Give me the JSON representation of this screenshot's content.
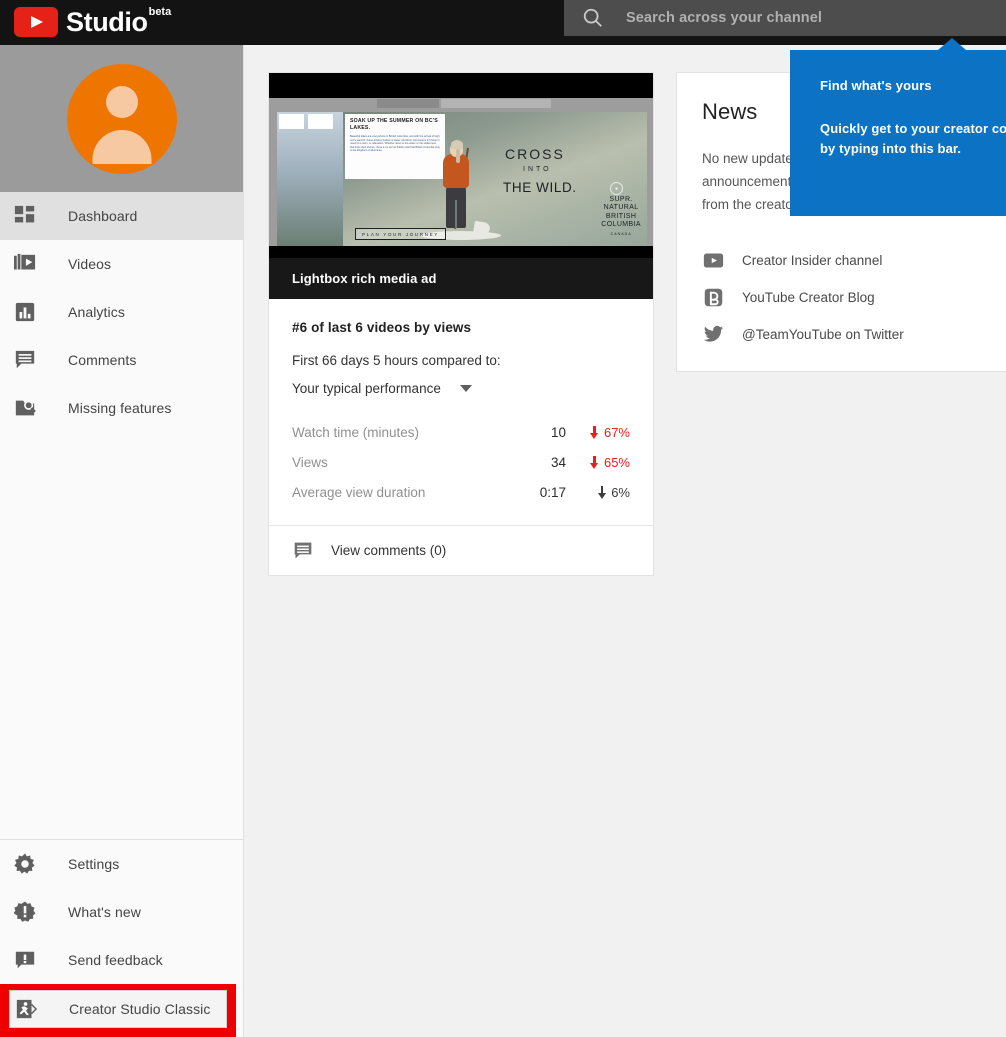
{
  "topbar": {
    "brand_name": "Studio",
    "brand_badge": "beta",
    "logo_icon": "youtube-play-icon",
    "search": {
      "icon": "search-icon",
      "placeholder": "Search across your channel",
      "value": ""
    }
  },
  "sidebar": {
    "avatar_icon": "default-user-avatar",
    "items": [
      {
        "label": "Dashboard",
        "icon": "dashboard-grid-icon",
        "active": true
      },
      {
        "label": "Videos",
        "icon": "videos-stack-icon",
        "active": false
      },
      {
        "label": "Analytics",
        "icon": "analytics-bar-icon",
        "active": false
      },
      {
        "label": "Comments",
        "icon": "comments-bubble-icon",
        "active": false
      },
      {
        "label": "Missing features",
        "icon": "missing-features-icon",
        "active": false
      }
    ],
    "bottom_items": [
      {
        "label": "Settings",
        "icon": "gear-icon"
      },
      {
        "label": "What's new",
        "icon": "exclamation-badge-icon"
      },
      {
        "label": "Send feedback",
        "icon": "feedback-bubble-icon"
      }
    ],
    "classic": {
      "label": "Creator Studio Classic",
      "icon": "exit-runner-icon",
      "highlight_color": "#ee0000",
      "highlighted": true
    }
  },
  "main": {
    "video_card": {
      "title": "Lightbox rich media ad",
      "rank_line": "#6 of last 6 videos by views",
      "compare_line": "First 66 days 5 hours compared to:",
      "compare_selected": "Your typical performance",
      "compare_caret_icon": "chevron-down-icon",
      "metrics": [
        {
          "name": "Watch time (minutes)",
          "value": "10",
          "delta": "67%",
          "direction": "down",
          "color": "#e62117"
        },
        {
          "name": "Views",
          "value": "34",
          "delta": "65%",
          "direction": "down",
          "color": "#e62117"
        },
        {
          "name": "Average view duration",
          "value": "0:17",
          "delta": "6%",
          "direction": "down",
          "color": "#3b3b3b"
        }
      ],
      "footer_label": "View comments (0)",
      "footer_icon": "comments-bubble-icon",
      "thumbnail": {
        "ad_headline": "SOAK UP THE SUMMER ON BC'S LAKES.",
        "ad_body": "Beautiful lakes are everywhere in British Columbia, and with the arrival of high sun's warmth, these pristine bodies of water transform into havens for those in need of a swim, or relaxation. Whether down to the water or the wilderness that lines their shores, there is no secret hidden well that British Columbia truly is the kingdom of adventure.",
        "ad_line1": "CROSS",
        "ad_line2": "INTO",
        "ad_line3": "THE WILD.",
        "ad_brand_1": "SUPR.",
        "ad_brand_2": "NATURAL",
        "ad_brand_3": "BRITISH",
        "ad_brand_4": "COLUMBIA",
        "ad_brand_5": "CANADA",
        "ad_cta": "PLAN YOUR JOURNEY"
      }
    },
    "news_card": {
      "title": "News",
      "body": "No new updates. Check here for announcements and updates from the creator community.",
      "links": [
        {
          "label": "Creator Insider channel",
          "icon": "youtube-play-icon"
        },
        {
          "label": "YouTube Creator Blog",
          "icon": "blogger-b-icon"
        },
        {
          "label": "@TeamYouTube on Twitter",
          "icon": "twitter-bird-icon"
        }
      ]
    }
  },
  "tooltip": {
    "title": "Find what's yours",
    "body": "Quickly get to your creator content by typing into this bar.",
    "background": "#0b72c4"
  }
}
